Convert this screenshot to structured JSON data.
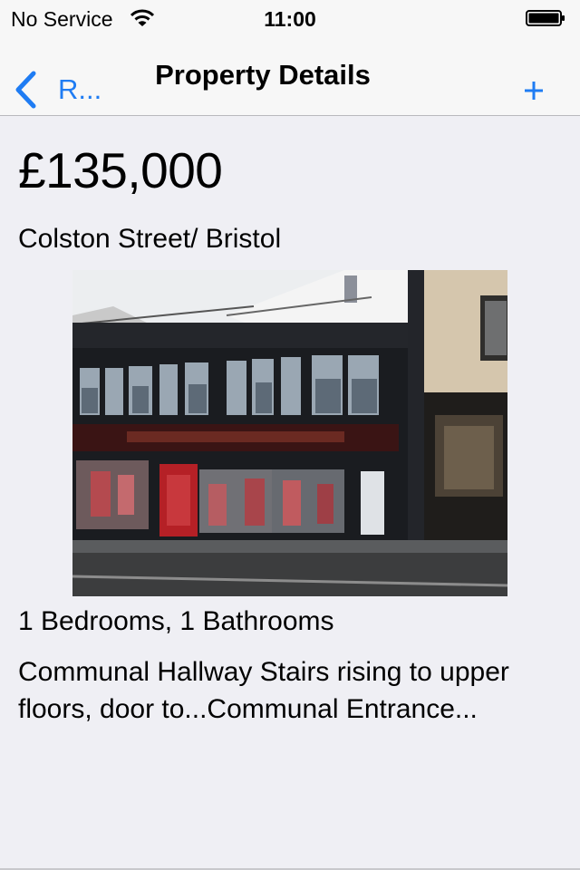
{
  "status_bar": {
    "carrier": "No Service",
    "time": "11:00",
    "wifi_icon": "wifi-icon",
    "battery_icon": "battery-icon",
    "battery_level": 1.0
  },
  "nav": {
    "back_label": "R...",
    "title": "Property Details",
    "back_icon": "chevron-left-icon",
    "add_icon": "plus-icon",
    "accent_color": "#1f7cf3"
  },
  "property": {
    "price": "£135,000",
    "address": "Colston Street/ Bristol",
    "rooms": "1 Bedrooms, 1 Bathrooms",
    "description": "Communal Hallway Stairs rising to upper floors, door to...Communal Entrance..."
  }
}
